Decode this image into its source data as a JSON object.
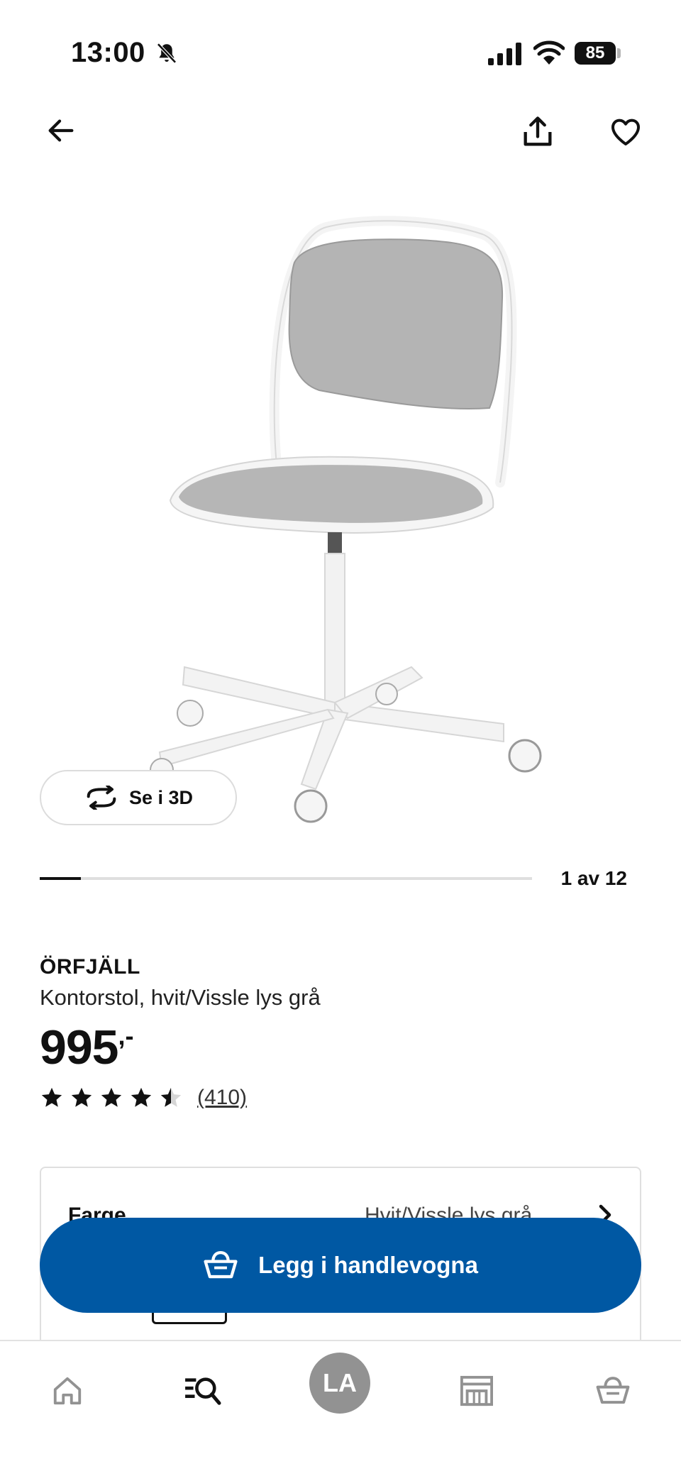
{
  "status_bar": {
    "time": "13:00",
    "battery": "85",
    "icons": [
      "bell-muted-icon",
      "signal-icon",
      "wifi-icon",
      "battery-icon"
    ]
  },
  "top_nav": {
    "icons": [
      "arrow-left-icon",
      "share-icon",
      "heart-icon"
    ]
  },
  "gallery": {
    "view_3d_label": "Se i 3D",
    "counter": "1 av 12",
    "current_image": 1,
    "total_images": 12
  },
  "product": {
    "name": "ÖRFJÄLL",
    "description": "Kontorstol, hvit/Vissle lys grå",
    "price": "995",
    "price_suffix": ",-",
    "rating": 4.5,
    "rating_max": 5,
    "review_count": "(410)"
  },
  "options": {
    "colour_label": "Farge",
    "colour_value": "Hvit/Vissle lys grå"
  },
  "cart_button": {
    "label": "Legg i handlevogna"
  },
  "bottom_nav": {
    "items": [
      {
        "icon": "home-icon"
      },
      {
        "icon": "search-list-icon"
      },
      {
        "avatar": "LA"
      },
      {
        "icon": "store-icon"
      },
      {
        "icon": "cart-icon"
      }
    ]
  },
  "colors": {
    "brand_blue": "#0058a3",
    "text": "#111111",
    "border": "#dfdfdf",
    "avatar": "#929292"
  }
}
